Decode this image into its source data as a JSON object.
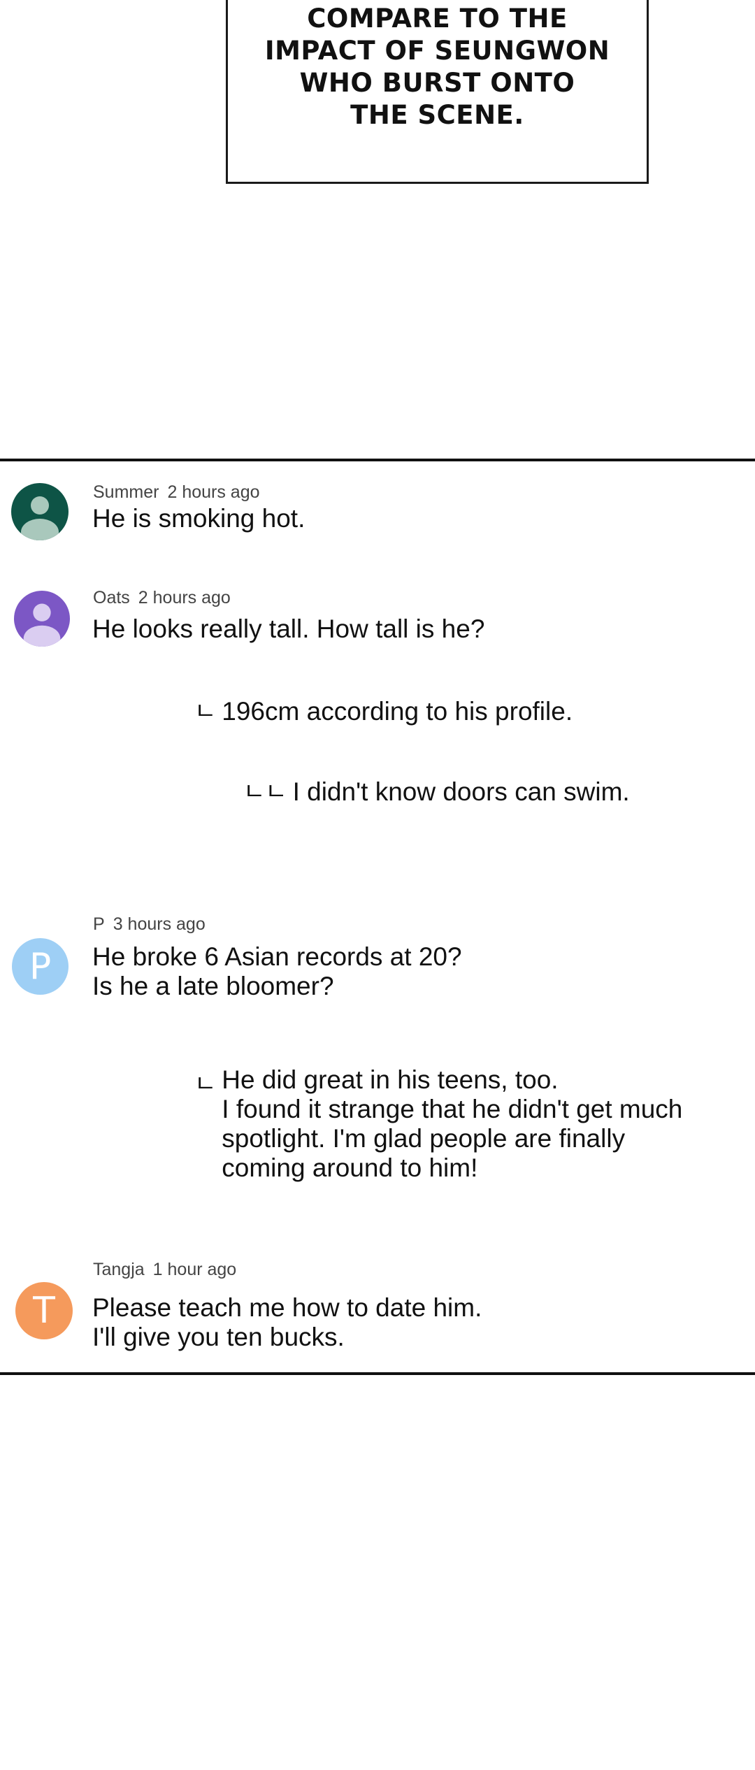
{
  "caption": {
    "text": "WHY DID NOT\nCOMPARE TO THE\nIMPACT OF SEUNGWON\nWHO BURST ONTO\nTHE SCENE."
  },
  "comments": [
    {
      "user": "Summer",
      "time": "2 hours ago",
      "text": "He is smoking hot.",
      "avatar": {
        "type": "person",
        "bg": "#0e5446",
        "fg": "#a9c8bc"
      }
    },
    {
      "user": "Oats",
      "time": "2 hours ago",
      "text": "He looks really tall. How tall is he?",
      "avatar": {
        "type": "person",
        "bg": "#7c57c5",
        "fg": "#dacdf1"
      },
      "replies": [
        {
          "marker": "ㄴ",
          "text": "196cm according to his profile."
        },
        {
          "marker": "ㄴㄴ",
          "text": "I didn't know doors can swim."
        }
      ]
    },
    {
      "user": "P",
      "time": "3 hours ago",
      "text": "He broke 6 Asian records at 20?\nIs he a late bloomer?",
      "avatar": {
        "type": "letter",
        "letter": "P",
        "bg": "#9ecff5"
      },
      "replies": [
        {
          "marker": "ㄴ",
          "text": "He did great in his teens, too.\nI found it strange that he didn't get much\nspotlight. I'm glad people are finally\ncoming around to him!"
        }
      ]
    },
    {
      "user": "Tangja",
      "time": "1 hour ago",
      "text": "Please teach me how to date him.\nI'll give you ten bucks.",
      "avatar": {
        "type": "letter",
        "letter": "T",
        "bg": "#f59a5c"
      }
    }
  ]
}
